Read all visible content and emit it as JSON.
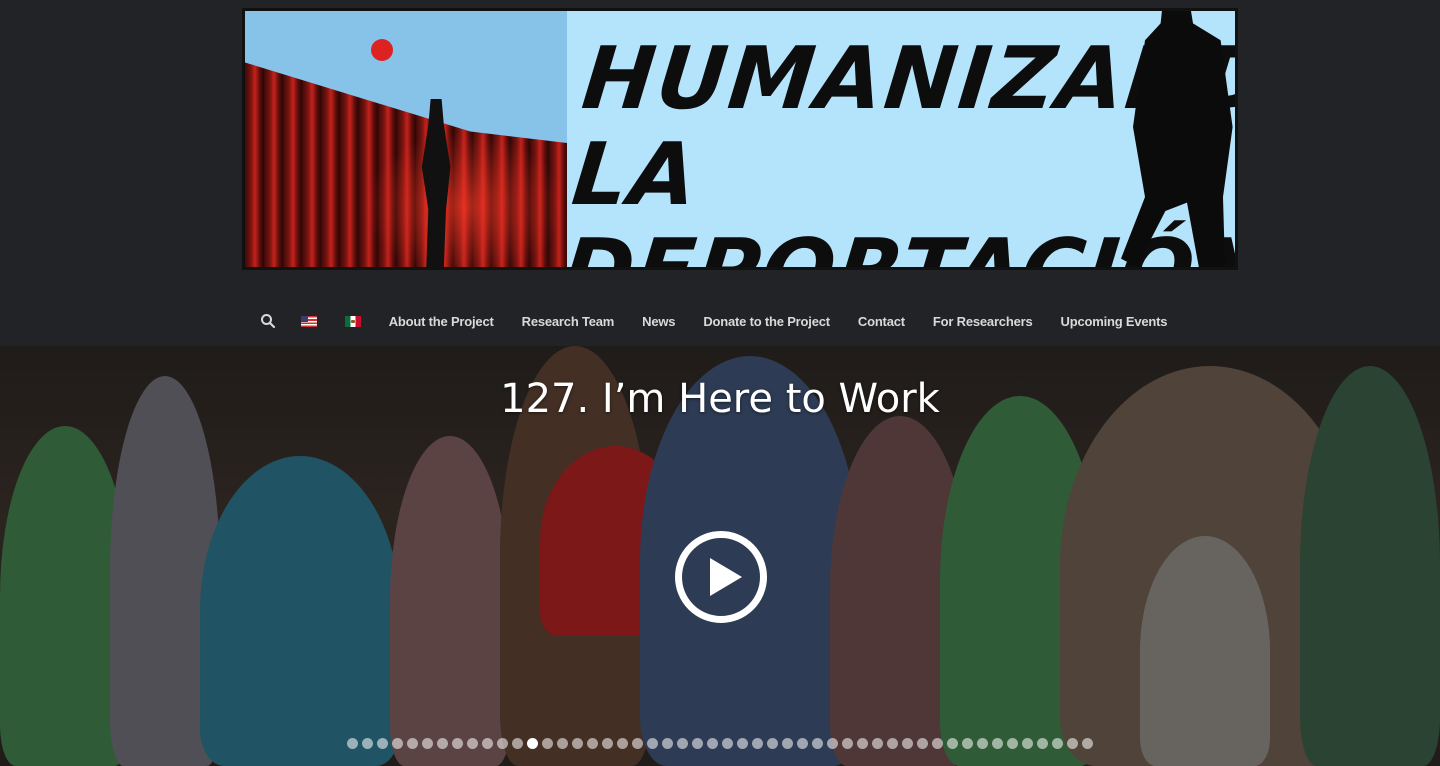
{
  "banner": {
    "title_line1": "Humanizando",
    "title_line2": "La Deportación"
  },
  "nav": {
    "search_icon": "search-icon",
    "flags": [
      {
        "name": "united-states-flag",
        "language": "English"
      },
      {
        "name": "mexico-flag",
        "language": "Español"
      }
    ],
    "items": [
      {
        "label": "About the Project"
      },
      {
        "label": "Research Team"
      },
      {
        "label": "News"
      },
      {
        "label": "Donate to the Project"
      },
      {
        "label": "Contact"
      },
      {
        "label": "For Researchers"
      },
      {
        "label": "Upcoming Events"
      }
    ]
  },
  "hero": {
    "title": "127. I’m Here to Work",
    "play_icon": "play-icon",
    "slides_total": 50,
    "active_slide": 12
  },
  "colors": {
    "background": "#222326",
    "nav_text": "#d9d9d9",
    "banner_sky": "#b4e4fb",
    "title_text": "#ffffff"
  }
}
